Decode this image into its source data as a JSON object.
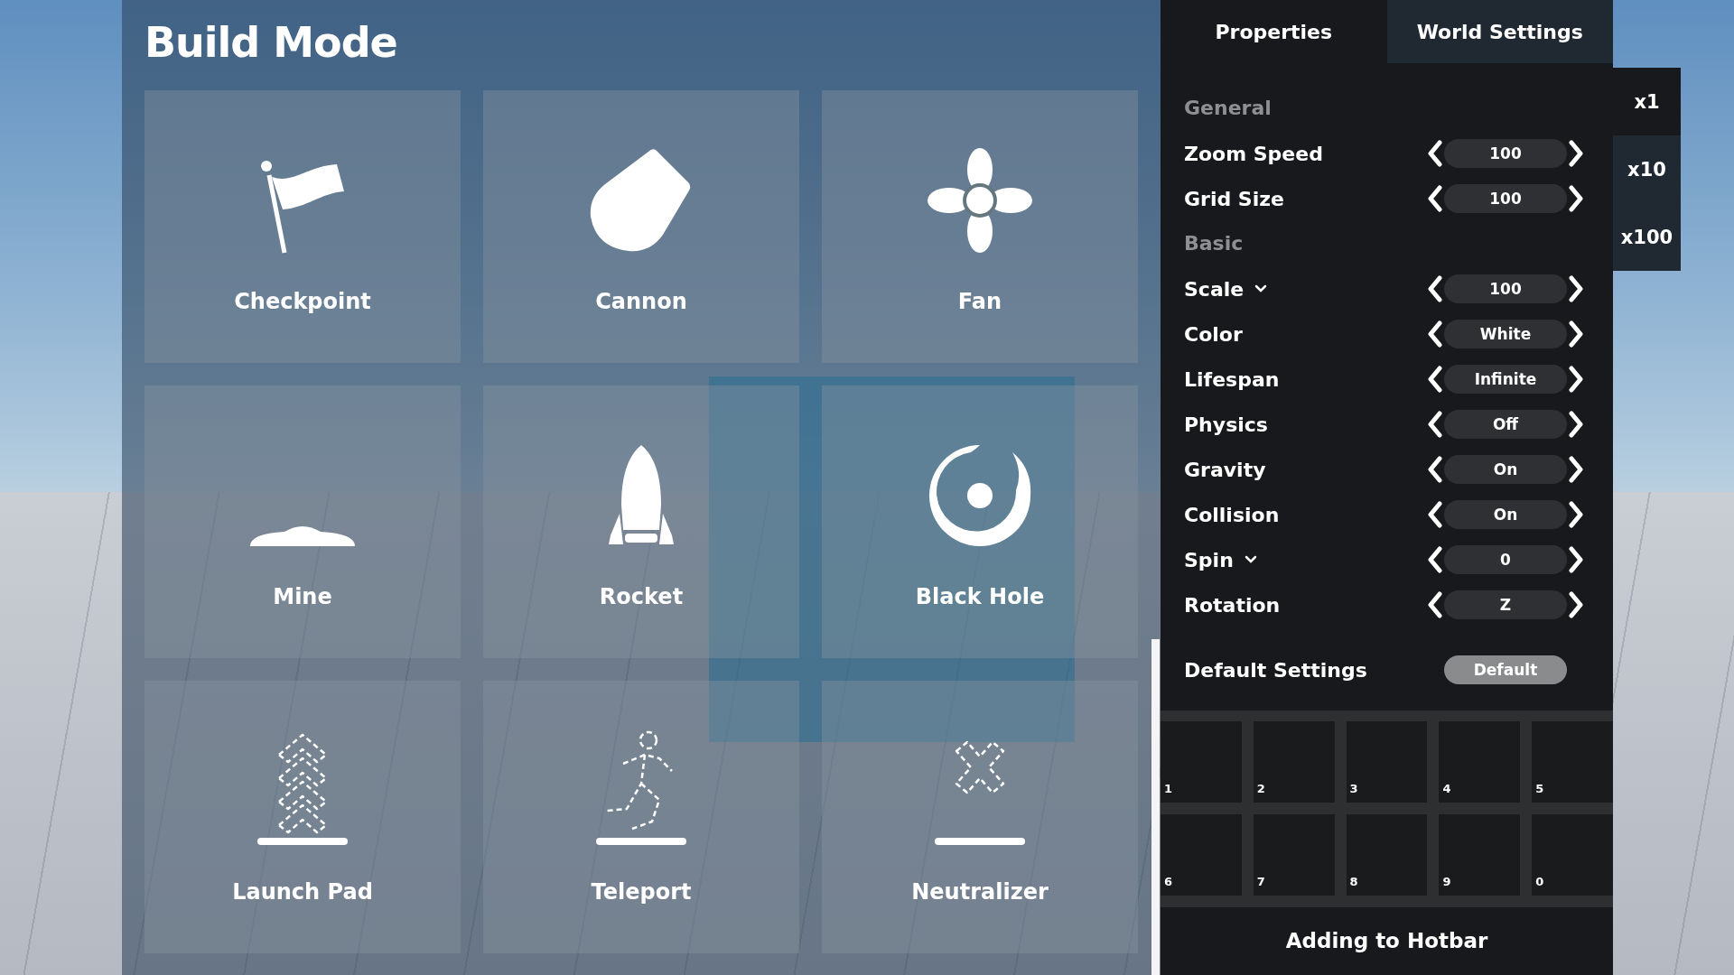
{
  "build_panel": {
    "title": "Build Mode",
    "items": [
      {
        "label": "Checkpoint",
        "kind": "flag"
      },
      {
        "label": "Cannon",
        "kind": "cannon"
      },
      {
        "label": "Fan",
        "kind": "fan"
      },
      {
        "label": "Mine",
        "kind": "mine"
      },
      {
        "label": "Rocket",
        "kind": "rocket"
      },
      {
        "label": "Black Hole",
        "kind": "blackhole"
      },
      {
        "label": "Launch Pad",
        "kind": "launchpad"
      },
      {
        "label": "Teleport",
        "kind": "teleport"
      },
      {
        "label": "Neutralizer",
        "kind": "neutralizer"
      }
    ],
    "drop_highlight": true
  },
  "tabs": [
    {
      "label": "Properties",
      "selected": true
    },
    {
      "label": "World Settings",
      "selected": false
    }
  ],
  "multipliers": [
    {
      "label": "x1",
      "selected": true
    },
    {
      "label": "x10",
      "selected": false
    },
    {
      "label": "x100",
      "selected": false
    }
  ],
  "rows": [
    {
      "kind": "heading",
      "label": "General"
    },
    {
      "kind": "setting",
      "label": "Zoom Speed",
      "value": "100",
      "dropdown": false
    },
    {
      "kind": "setting",
      "label": "Grid Size",
      "value": "100",
      "dropdown": false
    },
    {
      "kind": "heading",
      "label": "Basic"
    },
    {
      "kind": "setting",
      "label": "Scale",
      "value": "100",
      "dropdown": true
    },
    {
      "kind": "setting",
      "label": "Color",
      "value": "White",
      "dropdown": false
    },
    {
      "kind": "setting",
      "label": "Lifespan",
      "value": "Infinite",
      "dropdown": false
    },
    {
      "kind": "setting",
      "label": "Physics",
      "value": "Off",
      "dropdown": false
    },
    {
      "kind": "setting",
      "label": "Gravity",
      "value": "On",
      "dropdown": false
    },
    {
      "kind": "setting",
      "label": "Collision",
      "value": "On",
      "dropdown": false
    },
    {
      "kind": "setting",
      "label": "Spin",
      "value": "0",
      "dropdown": true
    },
    {
      "kind": "setting",
      "label": "Rotation",
      "value": "Z",
      "dropdown": false
    },
    {
      "kind": "button",
      "label": "Default Settings",
      "button": "Default"
    }
  ],
  "hotbar": {
    "slots": [
      "1",
      "2",
      "3",
      "4",
      "5",
      "6",
      "7",
      "8",
      "9",
      "0"
    ],
    "footer": "Adding to Hotbar"
  }
}
